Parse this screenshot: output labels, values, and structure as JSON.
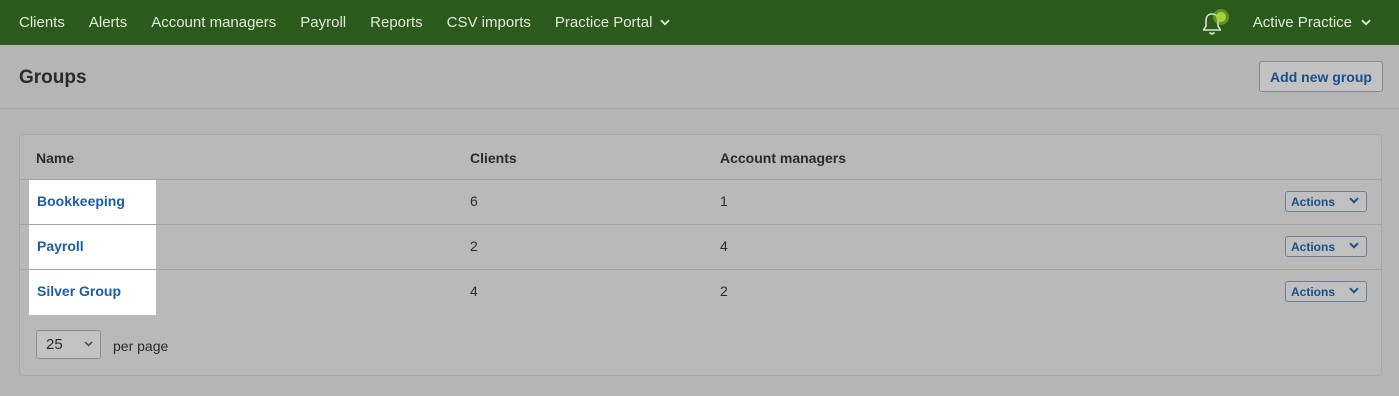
{
  "nav": {
    "items": [
      {
        "label": "Clients"
      },
      {
        "label": "Alerts"
      },
      {
        "label": "Account managers"
      },
      {
        "label": "Payroll"
      },
      {
        "label": "Reports"
      },
      {
        "label": "CSV imports"
      },
      {
        "label": "Practice Portal",
        "has_dropdown": true
      }
    ],
    "practice_label": "Active Practice",
    "icons": {
      "notifications": "bell-icon",
      "dropdown": "chevron-down-icon"
    }
  },
  "page": {
    "title": "Groups",
    "add_button_label": "Add new group"
  },
  "table": {
    "columns": [
      "Name",
      "Clients",
      "Account managers"
    ],
    "rows": [
      {
        "name": "Bookkeeping",
        "clients": "6",
        "account_managers": "1",
        "actions_label": "Actions"
      },
      {
        "name": "Payroll",
        "clients": "2",
        "account_managers": "4",
        "actions_label": "Actions"
      },
      {
        "name": "Silver Group",
        "clients": "4",
        "account_managers": "2",
        "actions_label": "Actions"
      }
    ]
  },
  "pagination": {
    "per_page_value": "25",
    "per_page_label": "per page"
  },
  "colors": {
    "nav_background": "#2b5a1d",
    "link": "#1c5ca8",
    "notification_dot": "#a8d23a"
  }
}
